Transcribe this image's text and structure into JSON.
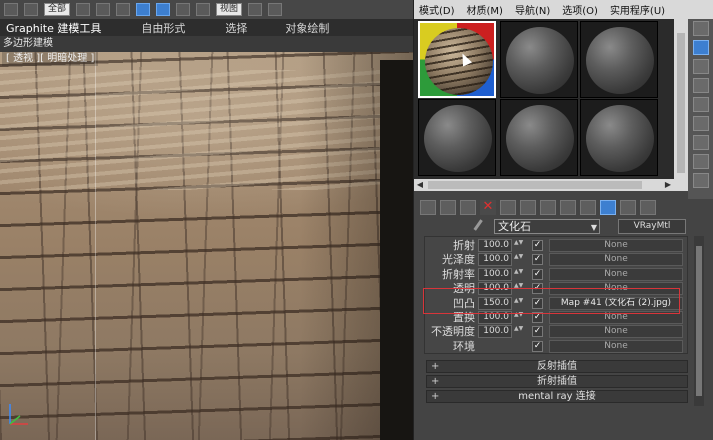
{
  "toolbar_strip": {
    "dropdown_left": "全部",
    "dropdown_right": "视图"
  },
  "ribbon": {
    "tabs": [
      "Graphite 建模工具",
      "自由形式",
      "选择",
      "对象绘制"
    ],
    "subtitle": "多边形建模"
  },
  "viewport": {
    "label": "[ 透视 ][ 明暗处理 ]"
  },
  "material_editor": {
    "menu": [
      "模式(D)",
      "材质(M)",
      "导航(N)",
      "选项(O)",
      "实用程序(U)"
    ],
    "material_name": "文化石",
    "material_type": "VRayMtl",
    "params": [
      {
        "label": "折射",
        "value": "100.0",
        "checked": true,
        "map": "None"
      },
      {
        "label": "光泽度",
        "value": "100.0",
        "checked": true,
        "map": "None"
      },
      {
        "label": "折射率",
        "value": "100.0",
        "checked": true,
        "map": "None"
      },
      {
        "label": "透明",
        "value": "100.0",
        "checked": true,
        "map": "None"
      },
      {
        "label": "凹凸",
        "value": "150.0",
        "checked": true,
        "map": "Map #41 (文化石 (2).jpg)"
      },
      {
        "label": "置换",
        "value": "100.0",
        "checked": true,
        "map": "None"
      },
      {
        "label": "不透明度",
        "value": "100.0",
        "checked": true,
        "map": "None"
      },
      {
        "label": "环境",
        "value": "",
        "checked": true,
        "map": "None"
      }
    ],
    "rollouts": [
      "反射插值",
      "折射插值",
      "mental ray 连接"
    ],
    "highlight_color": "#d8353a",
    "accent_color": "#3d7fd0"
  }
}
